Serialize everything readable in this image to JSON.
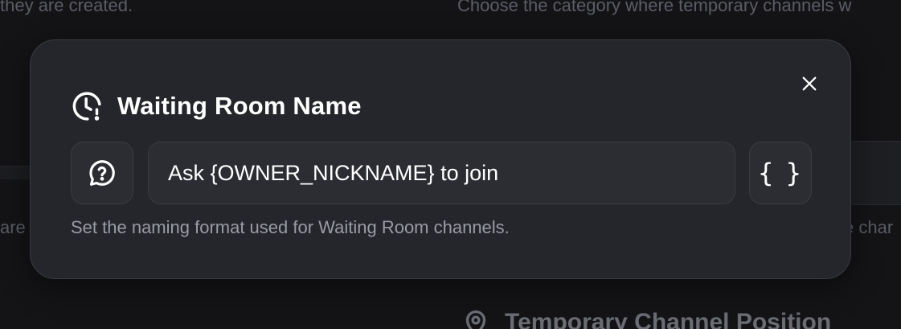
{
  "background": {
    "top_left_text": "they are created.",
    "top_right_text": "Choose the category where temporary channels w",
    "mid_left_text": "are",
    "mid_right_text": "e char",
    "section_heading": "Temporary Channel Position",
    "section_heading_icon": "location-pin-icon"
  },
  "modal": {
    "title": "Waiting Room Name",
    "title_icon": "clock-alert-icon",
    "close_icon": "close-icon",
    "input": {
      "value": "Ask {OWNER_NICKNAME} to join",
      "left_icon": "message-question-icon",
      "variables_button_label": "{ }"
    },
    "helper_text": "Set the naming format used for Waiting Room channels."
  },
  "colors": {
    "page_background": "#141417",
    "modal_background": "#25262b",
    "field_background": "#2c2d33",
    "text_primary": "#ffffff",
    "text_muted": "#9a9ca4"
  }
}
